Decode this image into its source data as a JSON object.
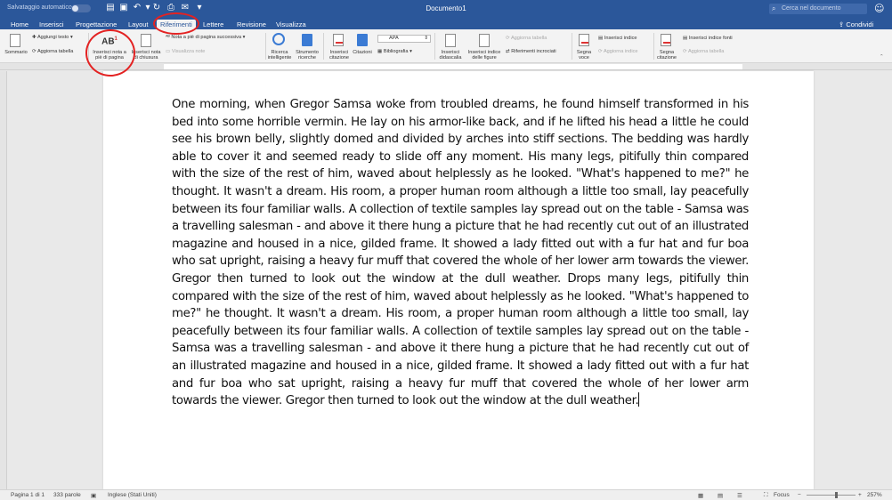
{
  "titlebar": {
    "autosave_label": "Salvataggio automatico",
    "document_title": "Documento1",
    "search_placeholder": "Cerca nel documento"
  },
  "tabs": [
    {
      "label": "Home"
    },
    {
      "label": "Inserisci"
    },
    {
      "label": "Progettazione"
    },
    {
      "label": "Layout"
    },
    {
      "label": "Riferimenti"
    },
    {
      "label": "Lettere"
    },
    {
      "label": "Revisione"
    },
    {
      "label": "Visualizza"
    }
  ],
  "share_label": "Condividi",
  "ribbon": {
    "summary": "Sommario",
    "add_text": "Aggiungi testo",
    "update_table": "Aggiorna tabella",
    "insert_footnote": "Inserisci nota a piè di pagina",
    "footnote_glyph": "AB",
    "footnote_sup": "1",
    "insert_endnote": "Inserisci nota di chiusura",
    "next_footnote": "Nota a piè di pagina successiva",
    "show_notes": "Visualizza note",
    "smart_lookup": "Ricerca intelligente",
    "researcher": "Strumento ricerche",
    "insert_citation": "Inserisci citazione",
    "citations": "Citazioni",
    "style_value": "APA",
    "bibliography": "Bibliografia",
    "insert_caption": "Inserisci didascalia",
    "insert_table_of_figures": "Inserisci indice delle figure",
    "update_figures_table": "Aggiorna tabella",
    "cross_reference": "Riferimenti incrociati",
    "mark_entry": "Segna voce",
    "insert_index": "Inserisci indice",
    "update_index": "Aggiorna indice",
    "mark_citation": "Segna citazione",
    "insert_table_of_authorities": "Inserisci indice fonti",
    "update_authorities": "Aggiorna tabella"
  },
  "document": {
    "body": "One morning, when Gregor Samsa woke from troubled dreams, he found himself transformed in his bed into some horrible vermin. He lay on his armor-like back, and if he lifted his head a little he could see his brown belly, slightly domed and divided by arches into stiff sections. The bedding was hardly able to cover it and seemed ready to slide off any moment. His many legs, pitifully thin compared with the size of the rest of him, waved about helplessly as he looked. \"What's happened to me?\" he thought. It wasn't a dream. His room, a proper human room although a little too small, lay peacefully between its four familiar walls. A collection of textile samples lay spread out on the table - Samsa was a travelling salesman - and above it there hung a picture that he had recently cut out of an illustrated magazine and housed in a nice, gilded frame. It showed a lady fitted out with a fur hat and fur boa who sat upright, raising a heavy fur muff that covered the whole of her lower arm towards the viewer. Gregor then turned to look out the window at the dull weather. Drops many legs, pitifully thin compared with the size of the rest of him, waved about helplessly as he looked. \"What's happened to me?\" he thought. It wasn't a dream. His room, a proper human room although a little too small, lay peacefully between its four familiar walls. A collection of textile samples lay spread out on the table - Samsa was a travelling salesman - and above it there hung a picture that he had recently cut out of an illustrated magazine and housed in a nice, gilded frame. It showed a lady fitted out with a fur hat and fur boa who sat upright, raising a heavy fur muff that covered the whole of her lower arm towards the viewer. Gregor then turned to look out the window at the dull weather."
  },
  "statusbar": {
    "page": "Pagina 1 di 1",
    "words": "333 parole",
    "language": "Inglese (Stati Uniti)",
    "focus": "Focus",
    "zoom": "257%"
  },
  "colors": {
    "accent": "#2b579a",
    "annotation": "#e32222"
  }
}
